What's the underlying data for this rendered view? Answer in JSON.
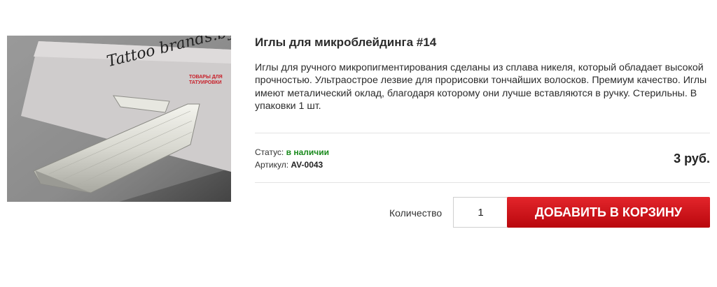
{
  "product": {
    "title": "Иглы для микроблейдинга #14",
    "description": "Иглы для ручного микропигментирования сделаны из сплава никеля, который обладает высокой прочностью. Ультраострое лезвие для прорисовки тончайших волосков. Премиум качество. Иглы имеют металический оклад, благодаря которому они лучше вставляются в ручку. Стерильны. В упаковки 1 шт.",
    "status_label": "Статус: ",
    "status_value": "в наличии",
    "sku_label": "Артикул: ",
    "sku_value": "AV-0043",
    "price": "3 руб."
  },
  "image": {
    "logo_text": "Tattoo brands.by",
    "logo_tagline_1": "ТОВАРЫ ДЛЯ",
    "logo_tagline_2": "ТАТУИРОВКИ"
  },
  "cart": {
    "quantity_label": "Количество",
    "quantity_value": "1",
    "add_button_label": "ДОБАВИТЬ В КОРЗИНУ"
  },
  "colors": {
    "status_green": "#198a1c",
    "button_red": "#d4161c",
    "logo_red": "#c8202a"
  }
}
